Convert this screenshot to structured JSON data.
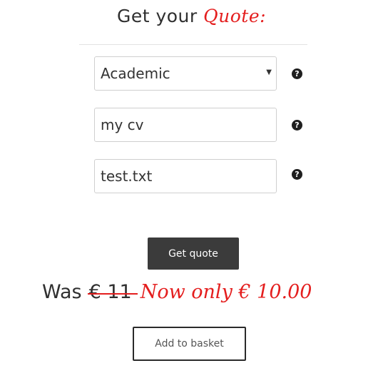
{
  "heading": {
    "prefix": "Get your",
    "accent": "Quote:"
  },
  "form": {
    "category": {
      "selected": "Academic",
      "help": "?"
    },
    "subject": {
      "value": "my cv",
      "help": "?"
    },
    "file": {
      "value": "test.txt",
      "help": "?"
    }
  },
  "buttons": {
    "get_quote": "Get quote",
    "add_to_basket": "Add to basket"
  },
  "price": {
    "was_label": "Was",
    "old_price": "€ 11",
    "now_text": "Now only € 10.00"
  },
  "colors": {
    "accent": "#e41e1e",
    "button_dark": "#3b3b3b"
  }
}
